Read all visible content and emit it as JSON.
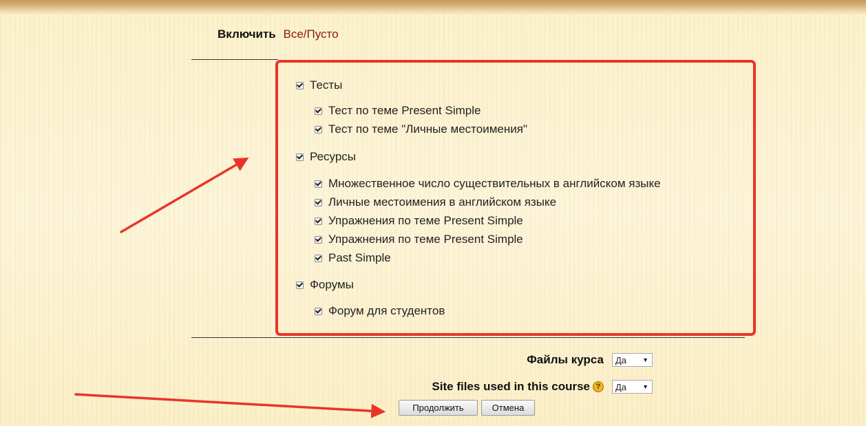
{
  "include": {
    "label": "Включить",
    "link": "Все/Пусто"
  },
  "sections": [
    {
      "label": "Тесты",
      "checked": true,
      "items": [
        {
          "label": "Тест по теме Present Simple",
          "checked": true
        },
        {
          "label": "Тест по теме \"Личные местоимения\"",
          "checked": true
        }
      ]
    },
    {
      "label": "Ресурсы",
      "checked": true,
      "items": [
        {
          "label": "Множественное число существительных в английском языке",
          "checked": true
        },
        {
          "label": "Личные местоимения в английском языке",
          "checked": true
        },
        {
          "label": "Упражнения по теме Present Simple",
          "checked": true
        },
        {
          "label": "Упражнения по теме Present Simple",
          "checked": true
        },
        {
          "label": "Past Simple",
          "checked": true
        }
      ]
    },
    {
      "label": "Форумы",
      "checked": true,
      "items": [
        {
          "label": "Форум для студентов",
          "checked": true
        }
      ]
    }
  ],
  "course_files": {
    "label": "Файлы курса",
    "value": "Да"
  },
  "site_files": {
    "label": "Site files used in this course",
    "value": "Да",
    "help_icon": "help-icon"
  },
  "buttons": {
    "continue": "Продолжить",
    "cancel": "Отмена"
  },
  "colors": {
    "highlight": "#e8352a",
    "link": "#8a1a0a",
    "background": "#fcf3d2"
  }
}
